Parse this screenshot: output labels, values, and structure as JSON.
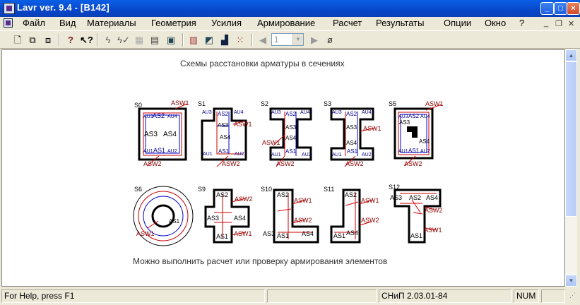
{
  "window": {
    "title": "Lavr ver. 9.4 - [B142]"
  },
  "menu": {
    "items": [
      "Файл",
      "Вид",
      "Материалы",
      "Геометрия",
      "Усилия",
      "Армирование",
      "Расчет",
      "Результаты",
      "Опции",
      "Окно",
      "?"
    ]
  },
  "toolbar": {
    "page_value": "1"
  },
  "content": {
    "heading": "Схемы расстановки арматуры в сечениях",
    "footer": "Можно выполнить расчет или проверку армирования элементов",
    "sections": [
      "S0",
      "S1",
      "S2",
      "S3",
      "S5",
      "S6",
      "S9",
      "S10",
      "S11",
      "S12"
    ]
  },
  "labels": {
    "asw1": "ASW1",
    "asw2": "ASW2",
    "as1": "AS1",
    "as2": "AS2",
    "as3": "AS3",
    "as4": "AS4",
    "au1": "AU1",
    "au2": "AU2",
    "au3": "AU3",
    "au4": "AU4"
  },
  "status": {
    "help": "For Help, press F1",
    "code": "СНиП 2.03.01-84",
    "num": "NUM"
  },
  "colors": {
    "rebar_label": "#8b0000",
    "corner_label": "#00008b",
    "outline": "#000000",
    "red_line": "#cc0000",
    "blue_circle": "#0000cc"
  }
}
